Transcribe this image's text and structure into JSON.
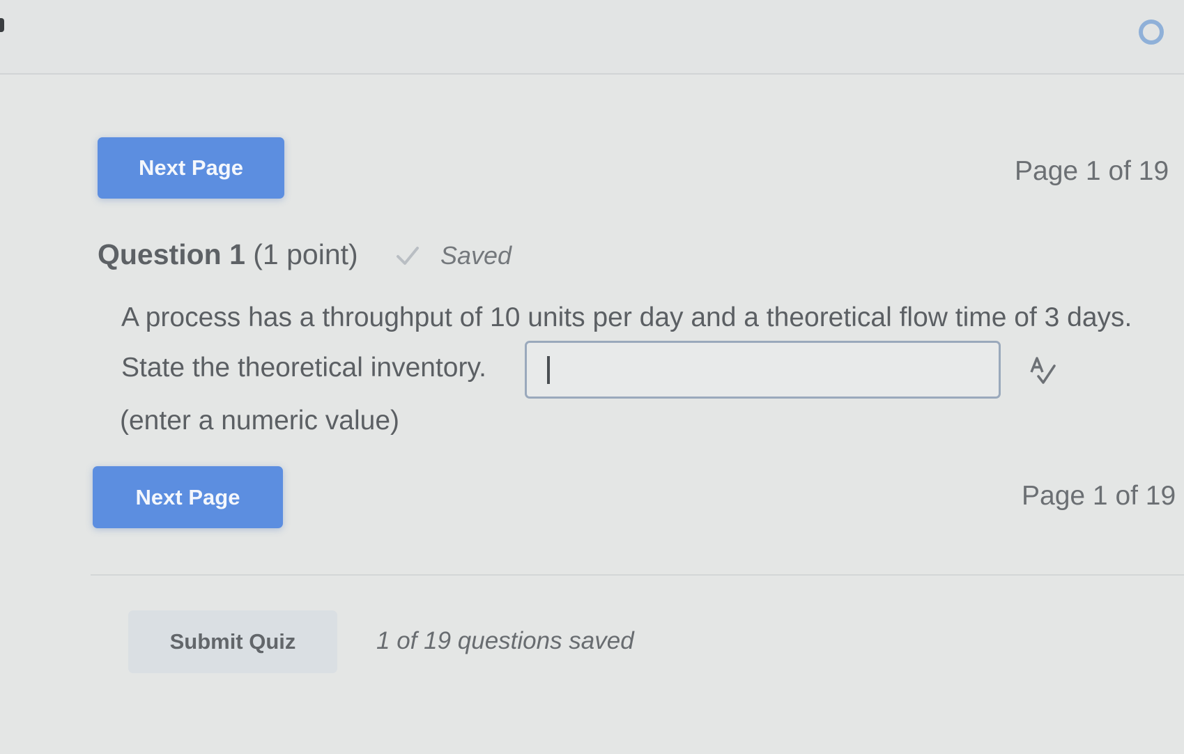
{
  "navigation": {
    "next_page_label": "Next Page",
    "page_indicator": "Page 1 of 19"
  },
  "question": {
    "title": "Question 1",
    "points": "(1 point)",
    "status": "Saved",
    "prompt_line1": "A process has a throughput of 10 units per day and a theoretical flow time of 3 days.",
    "prompt_line2": "State the theoretical inventory.",
    "answer_value": "",
    "hint": "(enter a numeric value)"
  },
  "footer": {
    "submit_label": "Submit Quiz",
    "saved_count": "1 of 19 questions saved"
  },
  "icons": {
    "loading": "loading-ring-icon",
    "saved": "checkmark-icon",
    "spellcheck": "spellcheck-icon"
  },
  "colors": {
    "primary_button": "#5c8ee0",
    "background": "#e4e6e5",
    "input_border": "#9aa9bc"
  }
}
